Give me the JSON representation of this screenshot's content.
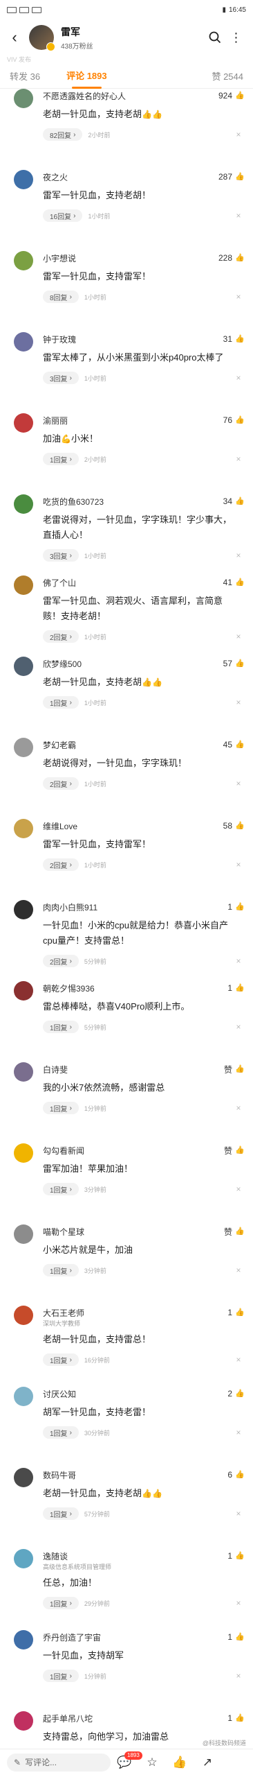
{
  "status_bar": {
    "icons_left": "signal wifi notification icons",
    "time": "16:45"
  },
  "header": {
    "title": "雷军",
    "fans": "438万粉丝"
  },
  "sub_faint": "VIV 发布",
  "tabs": {
    "repost": "转发 36",
    "comments": "评论 1893",
    "likes": "赞 2544"
  },
  "comments": [
    {
      "name": "不愿透露姓名的好心人",
      "sub": "",
      "likes": "924",
      "text": "老胡一针见血，支持老胡",
      "emoji": "👍👍",
      "replies": "82回复",
      "time": "2小时前",
      "color": "#6b8f71"
    },
    {
      "name": "夜之火",
      "sub": "",
      "likes": "287",
      "text": "雷军一针见血，支持老胡！",
      "emoji": "",
      "replies": "16回复",
      "time": "1小时前",
      "color": "#3e6fa8"
    },
    {
      "name": "小宇想说",
      "sub": "",
      "likes": "228",
      "text": "雷军一针见血，支持雷军！",
      "emoji": "",
      "replies": "8回复",
      "time": "1小时前",
      "color": "#7ba042"
    },
    {
      "name": "钟于玫瑰",
      "sub": "",
      "likes": "31",
      "text": "雷军太棒了，从小米黑蛋到小米p40pro太棒了",
      "emoji": "",
      "replies": "3回复",
      "time": "1小时前",
      "color": "#6c6fa0"
    },
    {
      "name": "渝丽丽",
      "sub": "",
      "likes": "76",
      "text": "加油",
      "emoji": "💪",
      "text2": "小米！",
      "replies": "1回复",
      "time": "2小时前",
      "color": "#c23a3a"
    },
    {
      "name": "吃货的鱼630723",
      "sub": "",
      "likes": "34",
      "text": "老雷说得对，一针见血，字字珠玑！字少事大，直插人心！",
      "emoji": "",
      "replies": "3回复",
      "time": "1小时前",
      "color": "#4a8c3f"
    },
    {
      "name": "佛了个山",
      "sub": "",
      "likes": "41",
      "text": "雷军一针见血、洞若观火、语言犀利，言简意赅！支持老胡！",
      "emoji": "",
      "replies": "2回复",
      "time": "1小时前",
      "color": "#b07d2b"
    },
    {
      "name": "欣梦缘500",
      "sub": "",
      "likes": "57",
      "text": "老胡一针见血，支持老胡",
      "emoji": "👍👍",
      "replies": "1回复",
      "time": "1小时前",
      "color": "#506070"
    },
    {
      "name": "梦幻老霸",
      "sub": "",
      "likes": "45",
      "text": "老胡说得对，一针见血，字字珠玑！",
      "emoji": "",
      "replies": "2回复",
      "time": "1小时前",
      "color": "#9a9a9a"
    },
    {
      "name": "维维Love",
      "sub": "",
      "likes": "58",
      "text": "雷军一针见血，支持雷军！",
      "emoji": "",
      "replies": "2回复",
      "time": "1小时前",
      "color": "#c9a24a"
    },
    {
      "name": "肉肉小白熊911",
      "sub": "",
      "likes": "1",
      "text": "一针见血！小米的cpu就是给力！恭喜小米自产cpu量产！支持雷总！",
      "emoji": "",
      "replies": "2回复",
      "time": "5分钟前",
      "color": "#2e2e2e"
    },
    {
      "name": "朝乾夕惕3936",
      "sub": "",
      "likes": "1",
      "text": "雷总棒棒哒，恭喜V40Pro顺利上市。",
      "emoji": "",
      "replies": "1回复",
      "time": "5分钟前",
      "color": "#8a3030"
    },
    {
      "name": "白诗斐",
      "sub": "",
      "likes": "赞",
      "text": "我的小米7依然流畅，感谢雷总",
      "emoji": "",
      "replies": "1回复",
      "time": "1分钟前",
      "color": "#7a6e8e"
    },
    {
      "name": "勾勾看新闻",
      "sub": "",
      "likes": "赞",
      "text": "雷军加油！苹果加油！",
      "emoji": "",
      "replies": "1回复",
      "time": "3分钟前",
      "color": "#f0b400"
    },
    {
      "name": "喵勒个星球",
      "sub": "",
      "likes": "赞",
      "text": "小米芯片就是牛，加油",
      "emoji": "",
      "replies": "1回复",
      "time": "3分钟前",
      "color": "#8c8c8c"
    },
    {
      "name": "大石王老师",
      "sub": "深圳大学教师",
      "likes": "1",
      "text": "老胡一针见血，支持雷总！",
      "emoji": "",
      "replies": "1回复",
      "time": "16分钟前",
      "color": "#c64b2a"
    },
    {
      "name": "讨厌公知",
      "sub": "",
      "likes": "2",
      "text": "胡军一针见血，支持老雷！",
      "emoji": "",
      "replies": "1回复",
      "time": "30分钟前",
      "color": "#7fb3c9"
    },
    {
      "name": "数码牛哥",
      "sub": "",
      "likes": "6",
      "text": "老胡一针见血，支持老胡",
      "emoji": "👍👍",
      "replies": "1回复",
      "time": "57分钟前",
      "color": "#4a4a4a"
    },
    {
      "name": "逸随谈",
      "sub": "高级信息系统项目管理师",
      "likes": "1",
      "text": "任总，加油！",
      "emoji": "",
      "replies": "1回复",
      "time": "29分钟前",
      "color": "#5fa6c2"
    },
    {
      "name": "乔丹创造了宇宙",
      "sub": "",
      "likes": "1",
      "text": "一针见血，支持胡军",
      "emoji": "",
      "replies": "1回复",
      "time": "1分钟前",
      "color": "#3f6ea8"
    },
    {
      "name": "起手单吊八坨",
      "sub": "",
      "likes": "1",
      "text": "支持雷总，向他学习，加油雷总",
      "emoji": "",
      "replies": "",
      "time": "",
      "color": "#c03060"
    }
  ],
  "bottom": {
    "write": "写评论...",
    "comment_count": "1893",
    "watermark": "@科技数码频道"
  }
}
